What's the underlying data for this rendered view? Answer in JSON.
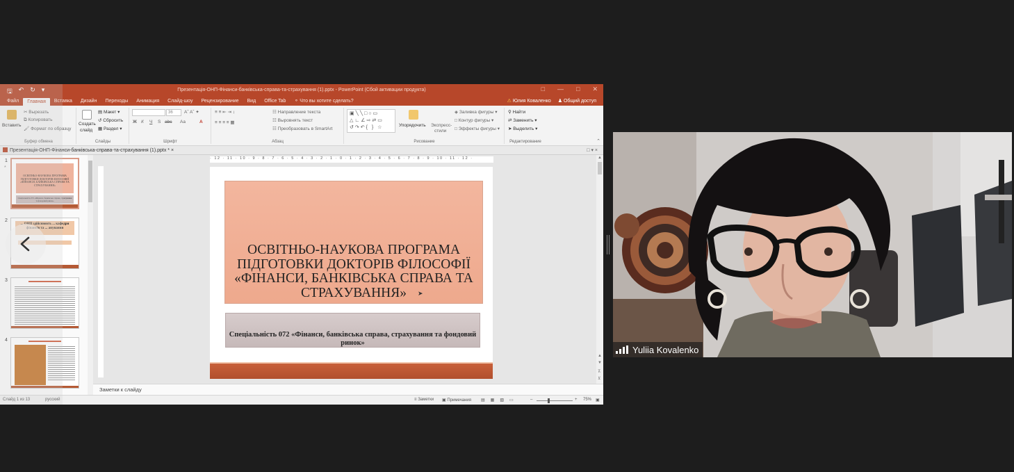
{
  "ppt": {
    "qat_icons": [
      "save-icon",
      "undo-icon",
      "redo-icon",
      "customize-icon"
    ],
    "window_title": "Презентація-ОНП-Фінанси-банківська-справа-та-страхування (1).pptx - PowerPoint (Сбой активации продукта)",
    "tabs": [
      {
        "label": "Файл",
        "active": false
      },
      {
        "label": "Главная",
        "active": true
      },
      {
        "label": "Вставка",
        "active": false
      },
      {
        "label": "Дизайн",
        "active": false
      },
      {
        "label": "Переходы",
        "active": false
      },
      {
        "label": "Анимация",
        "active": false
      },
      {
        "label": "Слайд-шоу",
        "active": false
      },
      {
        "label": "Рецензирование",
        "active": false
      },
      {
        "label": "Вид",
        "active": false
      },
      {
        "label": "Office Tab",
        "active": false
      }
    ],
    "tell_me": "Что вы хотите сделать?",
    "user_name": "Юлия Коваленко",
    "share": "Общий доступ",
    "ribbon": {
      "clipboard": {
        "paste": "Вставить",
        "cut": "Вырезать",
        "copy": "Копировать",
        "format_painter": "Формат по образцу",
        "group": "Буфер обмена"
      },
      "slides": {
        "new_slide_1": "Создать",
        "new_slide_2": "слайд",
        "layout": "Макет",
        "reset": "Сбросить",
        "section": "Раздел",
        "group": "Слайды"
      },
      "font": {
        "font_size": "36",
        "bold": "Ж",
        "italic": "К",
        "underline": "Ч",
        "strike": "S",
        "spacing": "abc",
        "case": "Аа",
        "group": "Шрифт"
      },
      "paragraph": {
        "text_direction": "Направление текста",
        "align_text": "Выровнять текст",
        "convert_smartart": "Преобразовать в SmartArt",
        "group": "Абзац"
      },
      "drawing": {
        "arrange": "Упорядочить",
        "quick_styles_1": "Экспресс-",
        "quick_styles_2": "стили",
        "shape_fill": "Заливка фигуры",
        "shape_outline": "Контур фигуры",
        "shape_effects": "Эффекты фигуры",
        "group": "Рисование"
      },
      "editing": {
        "find": "Найти",
        "replace": "Заменить",
        "select": "Выделить",
        "group": "Редактирование"
      }
    },
    "doc_tab": "Презентація-ОНП-Фінанси-банківська-справа-та-страхування (1).pptx *",
    "ruler_h": "· 12 · 11 · 10 · 9 · 8 · 7 · 6 · 5 · 4 · 3 · 2 · 1 · 0 · 1 · 2 · 3 · 4 · 5 · 6 · 7 · 8 · 9 · 10 · 11 · 12 ·",
    "thumbnails": [
      {
        "num": "1",
        "title": "ОСВІТНЬО-НАУКОВА ПРОГРАМА ПІДГОТОВКИ ДОКТОРІВ ФІЛОСОФІЇ «ФІНАНСИ, БАНКІВСЬКА СПРАВА ТА СТРАХУВАННЯ»",
        "sub": "Спеціальність 072 «Фінанси, банківська справа, страхування та фондовий ринок»"
      },
      {
        "num": "2",
        "title": "... ОНП здійснюють ... кафедри фінансів та ... анування"
      },
      {
        "num": "3",
        "title": "..."
      },
      {
        "num": "4",
        "title": "..."
      }
    ],
    "slide": {
      "title": "ОСВІТНЬО-НАУКОВА ПРОГРАМА ПІДГОТОВКИ ДОКТОРІВ ФІЛОСОФІЇ «ФІНАНСИ, БАНКІВСЬКА СПРАВА ТА СТРАХУВАННЯ»",
      "subtitle": "Спеціальність 072 «Фінанси, банківська справа, страхування та фондовий ринок»"
    },
    "notes_placeholder": "Заметки к слайду",
    "status": {
      "slide_counter": "Слайд 1 из 13",
      "language": "русский",
      "notes": "Заметки",
      "comments": "Примечания",
      "zoom": "75%"
    }
  },
  "participant": {
    "name": "Yuliia Kovalenko"
  }
}
